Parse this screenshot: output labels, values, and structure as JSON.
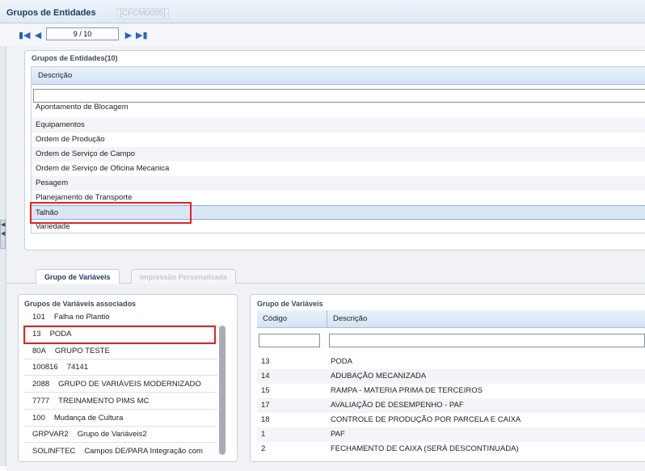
{
  "window": {
    "title": "Grupos de Entidades",
    "code": "[CFCM0095]"
  },
  "navigation": {
    "position": "9 / 10"
  },
  "entity_groups": {
    "title": "Grupos de Entidades(10)",
    "column_header": "Descrição",
    "rows": [
      "Apontamento de Blocagem",
      "Equipamentos",
      "Ordem de Produção",
      "Ordem de Serviço de Campo",
      "Ordem de Serviço de Oficina Mecanica",
      "Pesagem",
      "Planejamento de Transporte",
      "Talhão",
      "Variedade"
    ],
    "selected": "Talhão"
  },
  "tabs": [
    {
      "label": "Grupo de Variáveis",
      "active": true
    },
    {
      "label": "Impressão Personalizada",
      "active": false
    }
  ],
  "associated_groups": {
    "title": "Grupos de Variáveis associados",
    "rows": [
      {
        "code": "101",
        "desc": "Falha no Plantio"
      },
      {
        "code": "13",
        "desc": "PODA"
      },
      {
        "code": "80A",
        "desc": "GRUPO TESTE"
      },
      {
        "code": "100816",
        "desc": "74141"
      },
      {
        "code": "2088",
        "desc": "GRUPO DE VARIÁVEIS MODERNIZADO"
      },
      {
        "code": "7777",
        "desc": "TREINAMENTO PIMS MC"
      },
      {
        "code": "100",
        "desc": "Mudança de Cultura"
      },
      {
        "code": "GRPVAR2",
        "desc": "Grupo de Variáveis2"
      },
      {
        "code": "SOLINFTEC",
        "desc": "Campos DE/PARA Integração com"
      }
    ]
  },
  "variable_groups": {
    "title": "Grupo de Variáveis",
    "headers": {
      "code": "Código",
      "desc": "Descrição"
    },
    "rows": [
      {
        "code": "13",
        "desc": "PODA"
      },
      {
        "code": "14",
        "desc": "ADUBAÇÃO MECANIZADA"
      },
      {
        "code": "15",
        "desc": "RAMPA - MATERIA PRIMA DE TERCEIROS"
      },
      {
        "code": "17",
        "desc": "AVALIAÇÃO DE DESEMPENHO - PAF"
      },
      {
        "code": "18",
        "desc": "CONTROLE DE PRODUÇÃO POR PARCELA E CAIXA"
      },
      {
        "code": "1",
        "desc": "PAF"
      },
      {
        "code": "2",
        "desc": "FECHAMENTO DE CAIXA (SERÁ DESCONTINUADA)"
      }
    ]
  },
  "colors": {
    "accent": "#2b62b8",
    "highlight": "#d42a2a",
    "header": "#d3e3f5"
  }
}
